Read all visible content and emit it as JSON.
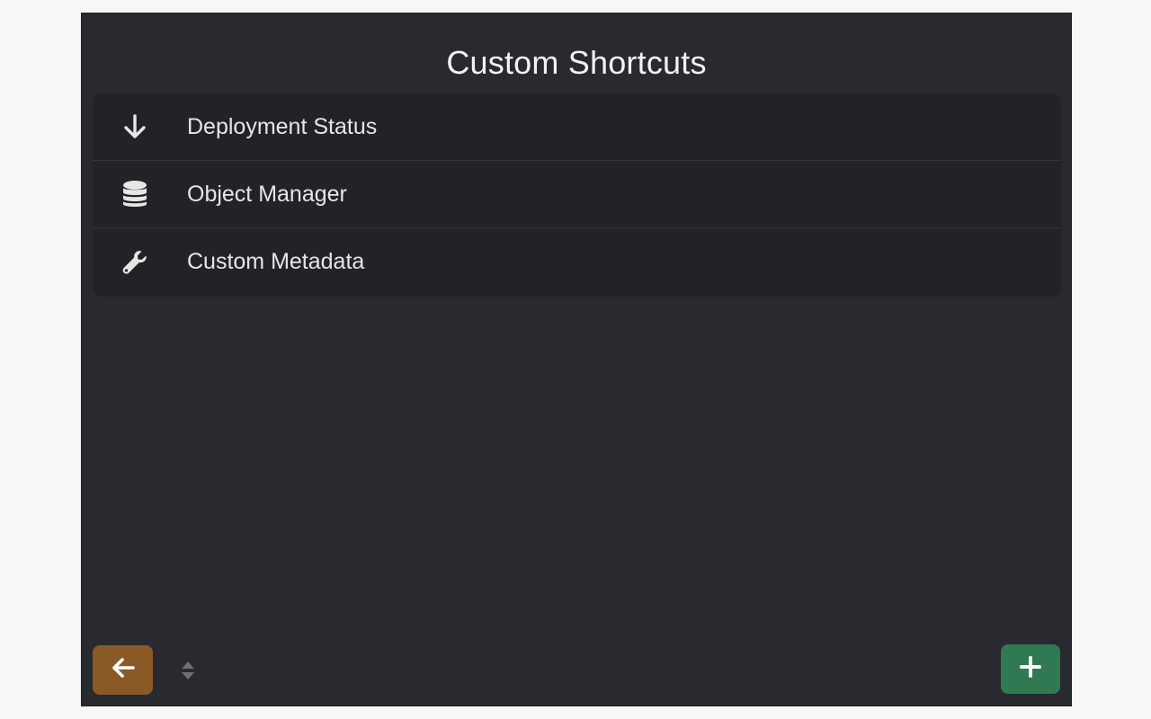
{
  "title": "Custom Shortcuts",
  "shortcuts": [
    {
      "label": "Deployment Status",
      "icon": "arrow-down-icon"
    },
    {
      "label": "Object Manager",
      "icon": "database-icon"
    },
    {
      "label": "Custom Metadata",
      "icon": "wrench-icon"
    }
  ],
  "footer": {
    "back_icon": "arrow-left-icon",
    "sort_icon": "sort-icon",
    "add_icon": "plus-icon"
  },
  "colors": {
    "background": "#292a2f",
    "list_background": "#222327",
    "back_button": "#8a5a26",
    "add_button": "#2f7a52",
    "text": "#e6e6e6"
  }
}
